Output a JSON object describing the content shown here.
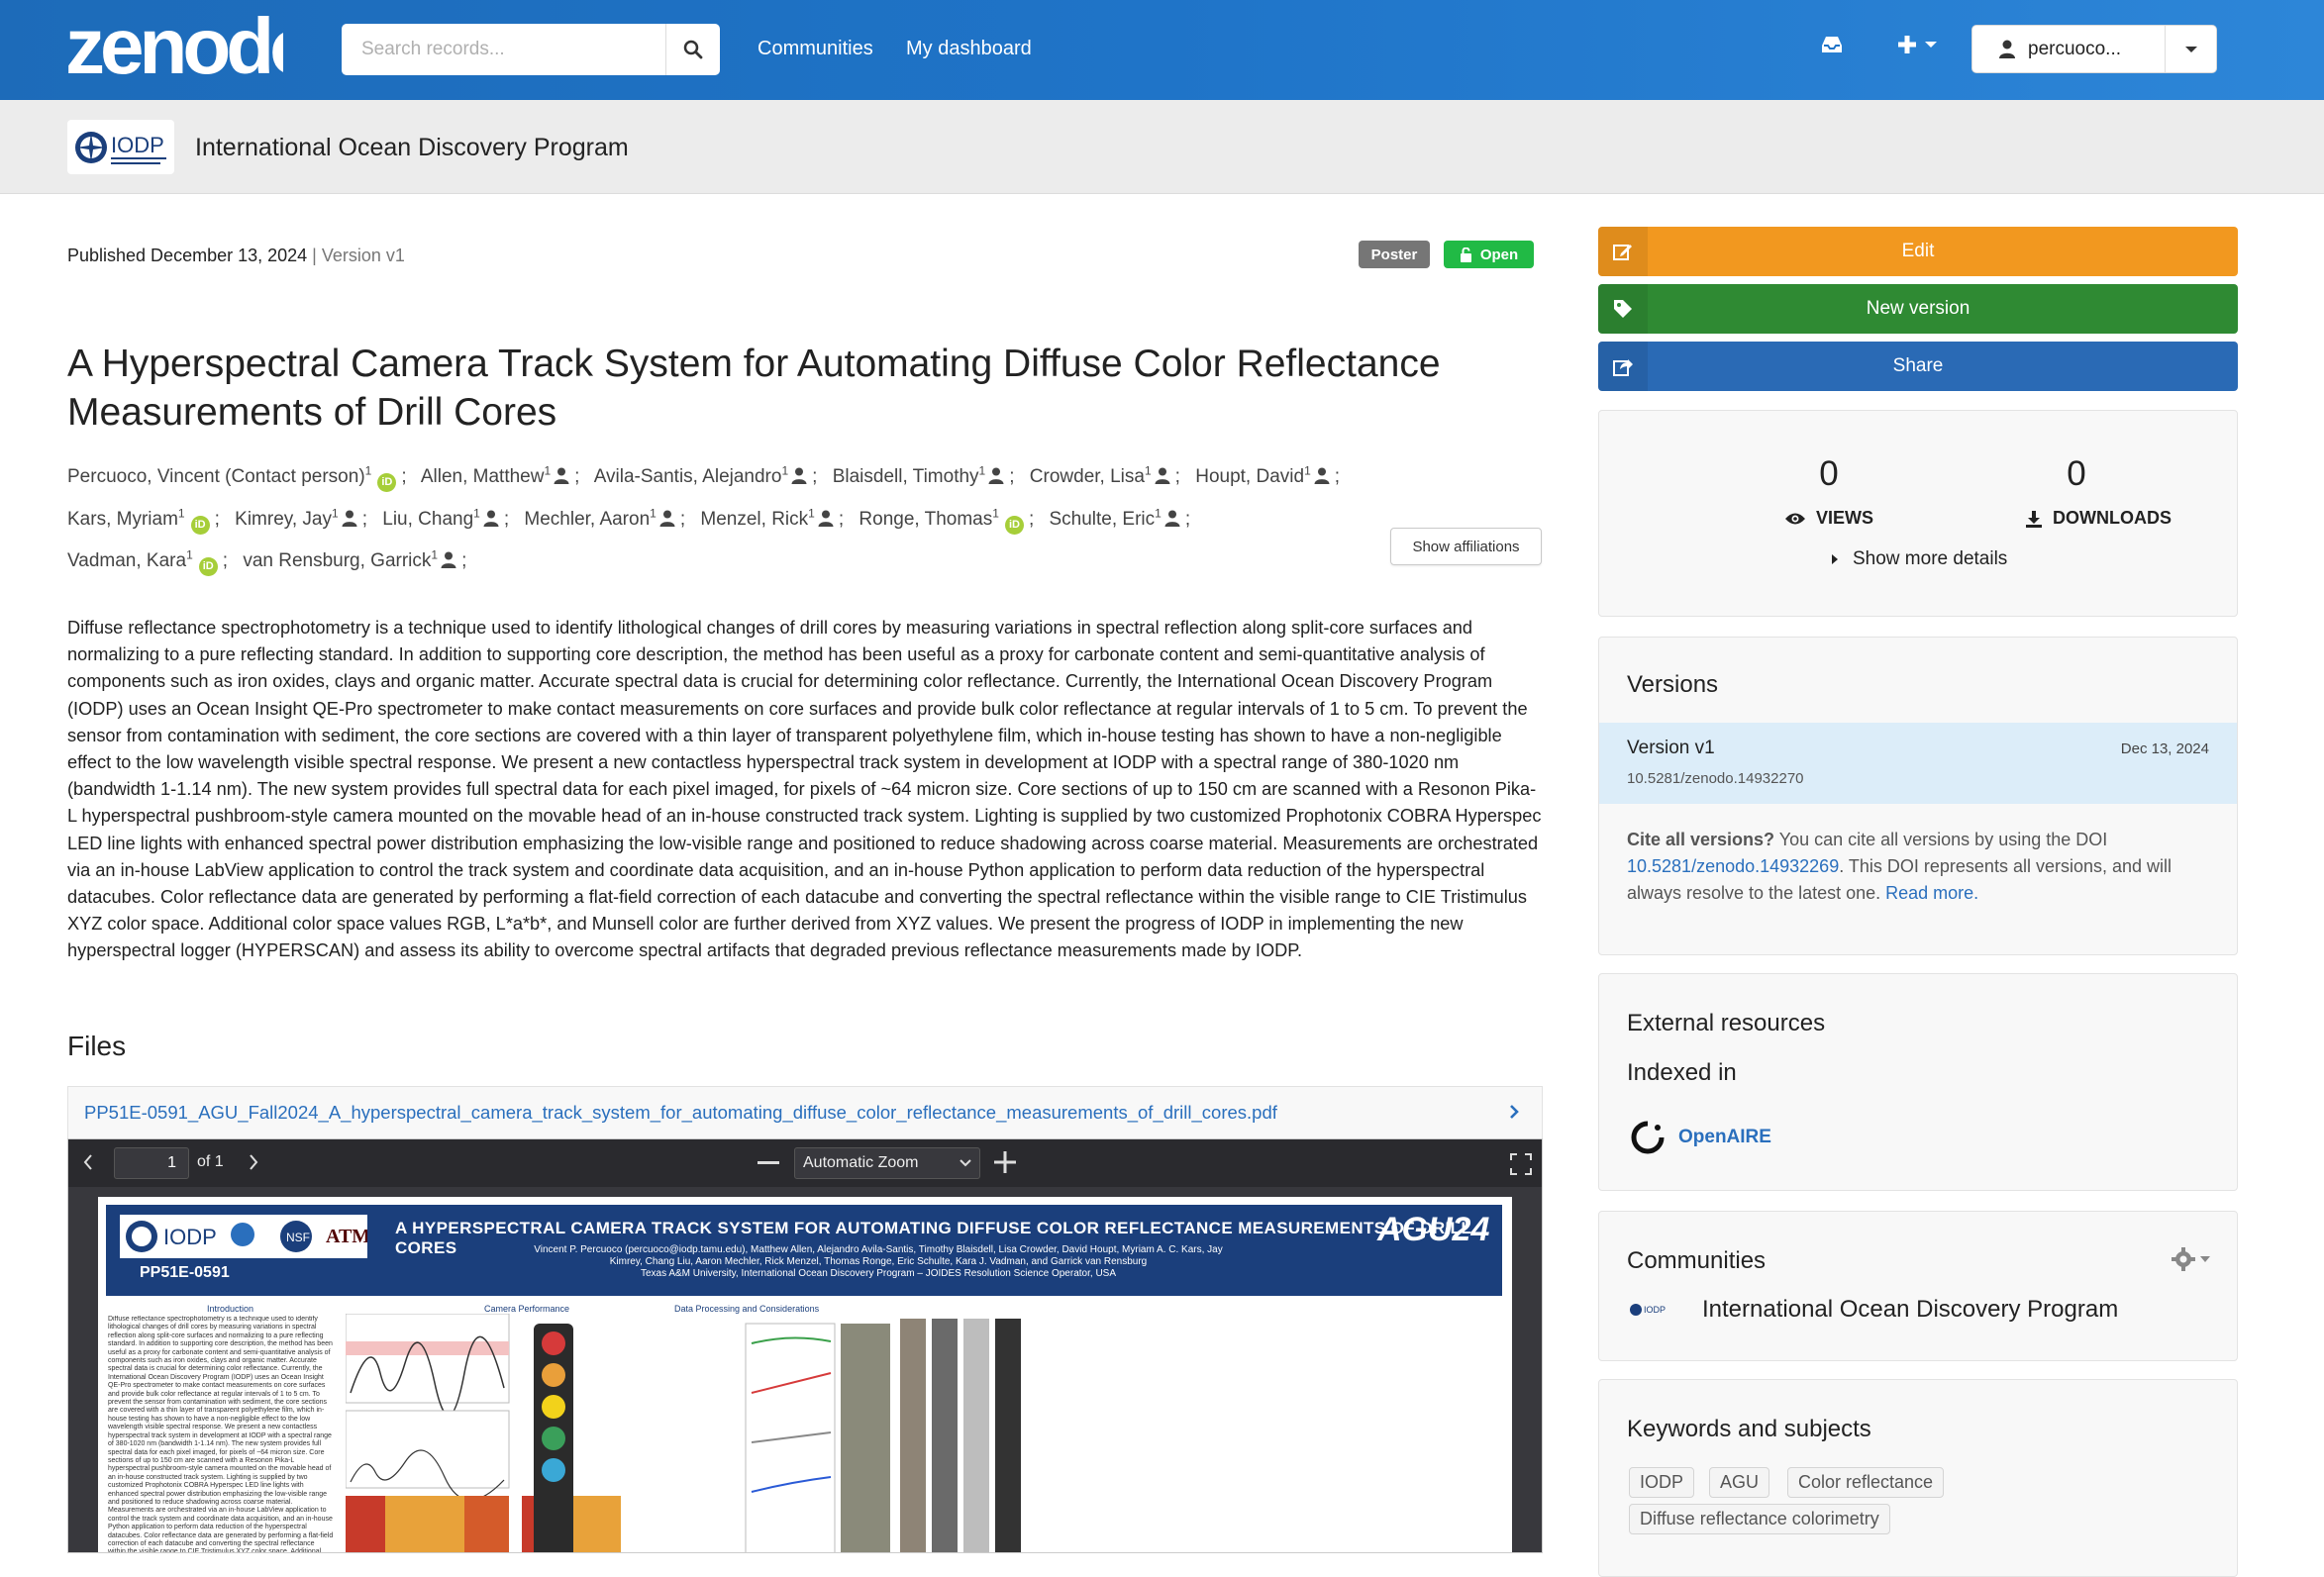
{
  "header": {
    "logo_text": "zenodo",
    "search_placeholder": "Search records...",
    "nav": [
      "Communities",
      "My dashboard"
    ],
    "user_label": "percuoco..."
  },
  "community_bar": {
    "logo_text": "IODP",
    "name": "International Ocean Discovery Program"
  },
  "record": {
    "published": "Published December 13, 2024",
    "version_sep": " | ",
    "version": "Version v1",
    "badge_type": "Poster",
    "badge_access": "Open",
    "title": "A Hyperspectral Camera Track System for Automating Diffuse Color Reflectance Measurements of Drill Cores",
    "creators": [
      {
        "name": "Percuoco, Vincent (Contact person)",
        "aff": "1",
        "orcid": true
      },
      {
        "name": "Allen, Matthew",
        "aff": "1",
        "orcid": false
      },
      {
        "name": "Avila-Santis, Alejandro",
        "aff": "1",
        "orcid": false
      },
      {
        "name": "Blaisdell, Timothy",
        "aff": "1",
        "orcid": false
      },
      {
        "name": "Crowder, Lisa",
        "aff": "1",
        "orcid": false
      },
      {
        "name": "Houpt, David",
        "aff": "1",
        "orcid": false
      },
      {
        "name": "Kars, Myriam",
        "aff": "1",
        "orcid": true
      },
      {
        "name": "Kimrey, Jay",
        "aff": "1",
        "orcid": false
      },
      {
        "name": "Liu, Chang",
        "aff": "1",
        "orcid": false
      },
      {
        "name": "Mechler, Aaron",
        "aff": "1",
        "orcid": false
      },
      {
        "name": "Menzel, Rick",
        "aff": "1",
        "orcid": false
      },
      {
        "name": "Ronge, Thomas",
        "aff": "1",
        "orcid": true
      },
      {
        "name": "Schulte, Eric",
        "aff": "1",
        "orcid": false
      },
      {
        "name": "Vadman, Kara",
        "aff": "1",
        "orcid": true
      },
      {
        "name": "van Rensburg, Garrick",
        "aff": "1",
        "orcid": false
      }
    ],
    "show_affiliations": "Show affiliations",
    "description": "Diffuse reflectance spectrophotometry is a technique used to identify lithological changes of drill cores by measuring variations in spectral reflection along split-core surfaces and normalizing to a pure reflecting standard. In addition to supporting core description, the method has been useful as a proxy for carbonate content and semi-quantitative analysis of components such as iron oxides, clays and organic matter. Accurate spectral data is crucial for determining color reflectance. Currently, the International Ocean Discovery Program (IODP) uses an Ocean Insight QE-Pro spectrometer to make contact measurements on core surfaces and provide bulk color reflectance at regular intervals of 1 to 5 cm. To prevent the sensor from contamination with sediment, the core sections are covered with a thin layer of transparent polyethylene film, which in-house testing has shown to have a non-negligible effect to the low wavelength visible spectral response. We present a new contactless hyperspectral track system in development at IODP with a spectral range of 380-1020 nm (bandwidth 1-1.14 nm). The new system provides full spectral data for each pixel imaged, for pixels of ~64 micron size. Core sections of up to 150 cm are scanned with a Resonon Pika-L hyperspectral pushbroom-style camera mounted on the movable head of an in-house constructed track system. Lighting is supplied by two customized Prophotonix COBRA Hyperspec LED line lights with enhanced spectral power distribution emphasizing the low-visible range and positioned to reduce shadowing across coarse material. Measurements are orchestrated via an in-house LabView application to control the track system and coordinate data acquisition, and an in-house Python application to perform data reduction of the hyperspectral datacubes. Color reflectance data are generated by performing a flat-field correction of each datacube and converting the spectral reflectance within the visible range to CIE Tristimulus XYZ color space. Additional color space values RGB, L*a*b*, and Munsell color are further derived from XYZ values. We present the progress of IODP in implementing the new hyperspectral logger (HYPERSCAN) and assess its ability to overcome spectral artifacts that degraded previous reflectance measurements made by IODP.",
    "files_heading": "Files",
    "file_name": "PP51E-0591_AGU_Fall2024_A_hyperspectral_camera_track_system_for_automating_diffuse_color_reflectance_measurements_of_drill_cores.pdf"
  },
  "pdf_viewer": {
    "page": "1",
    "of": "of 1",
    "zoom": "Automatic Zoom",
    "poster": {
      "title": "A HYPERSPECTRAL CAMERA TRACK SYSTEM FOR AUTOMATING DIFFUSE COLOR REFLECTANCE MEASUREMENTS OF DRILL CORES",
      "authors": "Vincent P. Percuoco (percuoco@iodp.tamu.edu), Matthew Allen, Alejandro Avila-Santis, Timothy Blaisdell, Lisa Crowder, David Houpt, Myriam A. C. Kars, Jay Kimrey, Chang Liu, Aaron Mechler, Rick Menzel, Thomas Ronge, Eric Schulte, Kara J. Vadman, and Garrick van Rensburg",
      "institution": "Texas A&M University, International Ocean Discovery Program – JOIDES Resolution Science Operator, USA",
      "id": "PP51E-0591",
      "conference": "AGU24",
      "col_heads": [
        "Introduction",
        "Camera Performance",
        "Data Processing and Considerations"
      ]
    }
  },
  "sidebar": {
    "edit": "Edit",
    "new_version": "New version",
    "share": "Share",
    "views_count": "0",
    "views_label": "VIEWS",
    "downloads_count": "0",
    "downloads_label": "DOWNLOADS",
    "show_more": "Show more details",
    "versions_heading": "Versions",
    "version_name": "Version v1",
    "version_date": "Dec 13, 2024",
    "version_doi": "10.5281/zenodo.14932270",
    "cite_bold": "Cite all versions?",
    "cite_text1": " You can cite all versions by using the DOI ",
    "cite_doi": "10.5281/zenodo.14932269",
    "cite_text2": ". This DOI represents all versions, and will always resolve to the latest one. ",
    "read_more": "Read more.",
    "external_heading": "External resources",
    "indexed_in": "Indexed in",
    "openaire": "OpenAIRE",
    "communities_heading": "Communities",
    "community_name": "International Ocean Discovery Program",
    "keywords_heading": "Keywords and subjects",
    "keywords": [
      "IODP",
      "AGU",
      "Color reflectance",
      "Diffuse reflectance colorimetry"
    ]
  },
  "colors": {
    "header_blue": "#1f74c8",
    "edit_orange": "#f2981f",
    "new_green": "#2f8a33",
    "share_blue": "#2a6ab5",
    "open_green": "#21ba45",
    "link_blue": "#2a6fbd"
  }
}
